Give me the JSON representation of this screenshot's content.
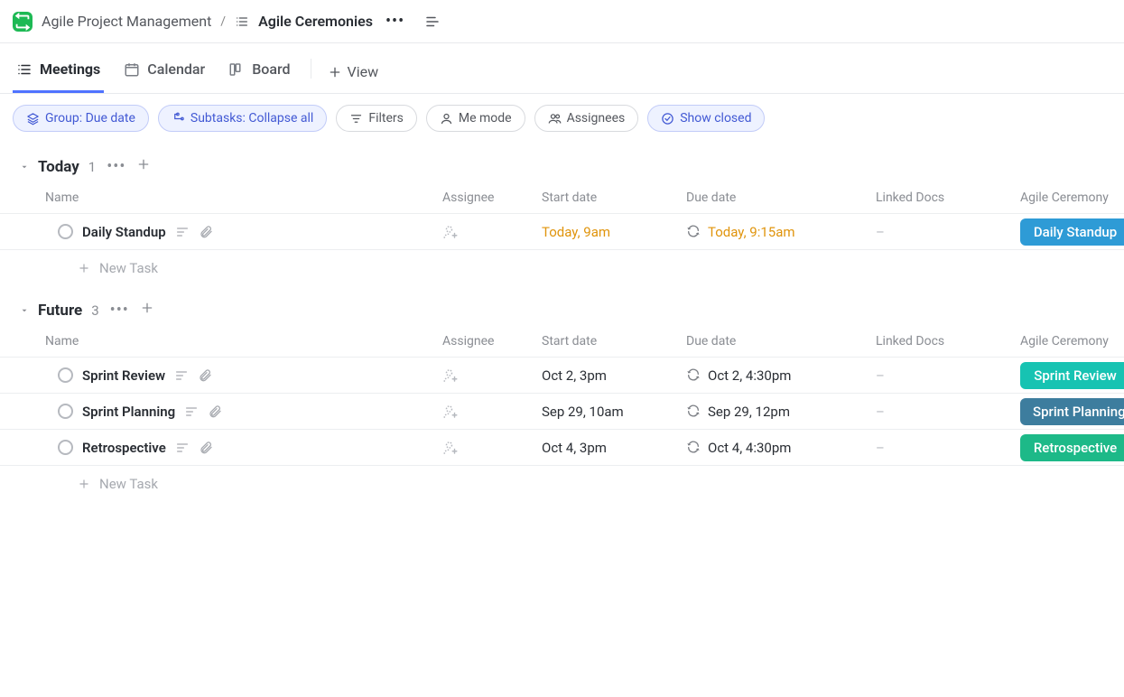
{
  "breadcrumb": {
    "space": "Agile Project Management",
    "page": "Agile Ceremonies"
  },
  "tabs": [
    {
      "label": "Meetings",
      "icon": "list",
      "active": true
    },
    {
      "label": "Calendar",
      "icon": "calendar",
      "active": false
    },
    {
      "label": "Board",
      "icon": "board",
      "active": false
    }
  ],
  "addView": "View",
  "filters": {
    "group": "Group: Due date",
    "subtasks": "Subtasks: Collapse all",
    "filters": "Filters",
    "meMode": "Me mode",
    "assignees": "Assignees",
    "showClosed": "Show closed"
  },
  "columns": [
    "Name",
    "Assignee",
    "Start date",
    "Due date",
    "Linked Docs",
    "Agile Ceremony"
  ],
  "newTask": "New Task",
  "groups": [
    {
      "title": "Today",
      "count": "1",
      "tasks": [
        {
          "name": "Daily Standup",
          "start": "Today, 9am",
          "startClass": "date-today",
          "recurring": true,
          "due": "Today, 9:15am",
          "dueClass": "due-today",
          "linked": "–",
          "ceremony": "Daily Standup",
          "ceremonyColor": "#2e9bd6"
        }
      ]
    },
    {
      "title": "Future",
      "count": "3",
      "tasks": [
        {
          "name": "Sprint Review",
          "start": "Oct 2, 3pm",
          "startClass": "",
          "recurring": true,
          "due": "Oct 2, 4:30pm",
          "dueClass": "",
          "linked": "–",
          "ceremony": "Sprint Review",
          "ceremonyColor": "#17c3b2"
        },
        {
          "name": "Sprint Planning",
          "start": "Sep 29, 10am",
          "startClass": "",
          "recurring": true,
          "due": "Sep 29, 12pm",
          "dueClass": "",
          "linked": "–",
          "ceremony": "Sprint Planning",
          "ceremonyColor": "#3d7d9e"
        },
        {
          "name": "Retrospective",
          "start": "Oct 4, 3pm",
          "startClass": "",
          "recurring": true,
          "due": "Oct 4, 4:30pm",
          "dueClass": "",
          "linked": "–",
          "ceremony": "Retrospective",
          "ceremonyColor": "#1db988"
        }
      ]
    }
  ]
}
